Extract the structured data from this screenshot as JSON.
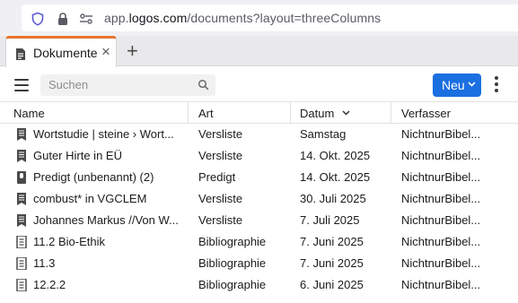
{
  "browser": {
    "url_prefix": "app.",
    "url_host": "logos.com",
    "url_path": "/documents?layout=threeColumns"
  },
  "tabs": [
    {
      "label": "Dokumente",
      "close": "×"
    }
  ],
  "tab_add": "+",
  "toolbar": {
    "search_placeholder": "Suchen",
    "new_button": "Neu"
  },
  "table": {
    "columns": [
      "Name",
      "Art",
      "Datum",
      "Verfasser"
    ],
    "sorted_column": "Datum",
    "rows": [
      {
        "icon": "wordlist-icon",
        "name": "Wortstudie | steine › Wort...",
        "art": "Versliste",
        "date": "Samstag",
        "author": "NichtnurBibel..."
      },
      {
        "icon": "wordlist-icon",
        "name": "Guter Hirte in EÜ",
        "art": "Versliste",
        "date": "14. Okt. 2025",
        "author": "NichtnurBibel..."
      },
      {
        "icon": "sermon-icon",
        "name": "Predigt (unbenannt) (2)",
        "art": "Predigt",
        "date": "14. Okt. 2025",
        "author": "NichtnurBibel..."
      },
      {
        "icon": "wordlist-icon",
        "name": "combust* in VGCLEM",
        "art": "Versliste",
        "date": "30. Juli 2025",
        "author": "NichtnurBibel..."
      },
      {
        "icon": "wordlist-icon",
        "name": "Johannes Markus //Von W...",
        "art": "Versliste",
        "date": "7. Juli 2025",
        "author": "NichtnurBibel..."
      },
      {
        "icon": "bibliography-icon",
        "name": "11.2 Bio-Ethik",
        "art": "Bibliographie",
        "date": "7. Juni 2025",
        "author": "NichtnurBibel..."
      },
      {
        "icon": "bibliography-icon",
        "name": "11.3",
        "art": "Bibliographie",
        "date": "7. Juni 2025",
        "author": "NichtnurBibel..."
      },
      {
        "icon": "bibliography-icon",
        "name": "12.2.2",
        "art": "Bibliographie",
        "date": "6. Juni 2025",
        "author": "NichtnurBibel..."
      }
    ]
  },
  "colors": {
    "accent": "#1b6fe0",
    "tab_highlight": "#e8742a"
  }
}
